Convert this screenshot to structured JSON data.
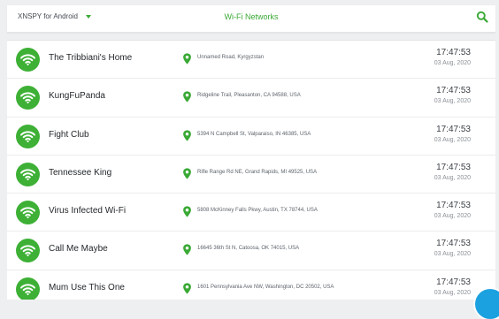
{
  "header": {
    "app_selector": "XNSPY for Android",
    "title": "Wi-Fi Networks"
  },
  "networks": [
    {
      "name": "The Tribbiani's Home",
      "address": "Unnamed Road, Kyrgyzstan",
      "time": "17:47:53",
      "date": "03 Aug, 2020"
    },
    {
      "name": "KungFuPanda",
      "address": "Ridgeline Trail, Pleasanton, CA 94588, USA",
      "time": "17:47:53",
      "date": "03 Aug, 2020"
    },
    {
      "name": "Fight Club",
      "address": "5394 N Campbell St, Valparaiso, IN 46385, USA",
      "time": "17:47:53",
      "date": "03 Aug, 2020"
    },
    {
      "name": "Tennessee King",
      "address": "Rifle Range Rd NE, Grand Rapids, MI 49525, USA",
      "time": "17:47:53",
      "date": "03 Aug, 2020"
    },
    {
      "name": "Virus Infected Wi-Fi",
      "address": "5808 McKinney Falls Pkwy, Austin, TX 78744, USA",
      "time": "17:47:53",
      "date": "03 Aug, 2020"
    },
    {
      "name": "Call Me Maybe",
      "address": "16645 36th St N, Catoosa, OK 74015, USA",
      "time": "17:47:53",
      "date": "03 Aug, 2020"
    },
    {
      "name": "Mum Use This One",
      "address": "1601 Pennsylvania Ave NW, Washington, DC 20502, USA",
      "time": "17:47:53",
      "date": "03 Aug, 2020"
    }
  ],
  "colors": {
    "accent": "#3aa935",
    "wifi_badge": "#3db035",
    "help_button": "#1ba1e0"
  },
  "icons": {
    "search": "search-icon",
    "wifi": "wifi-icon",
    "location": "location-pin-icon",
    "dropdown": "chevron-down-icon"
  }
}
